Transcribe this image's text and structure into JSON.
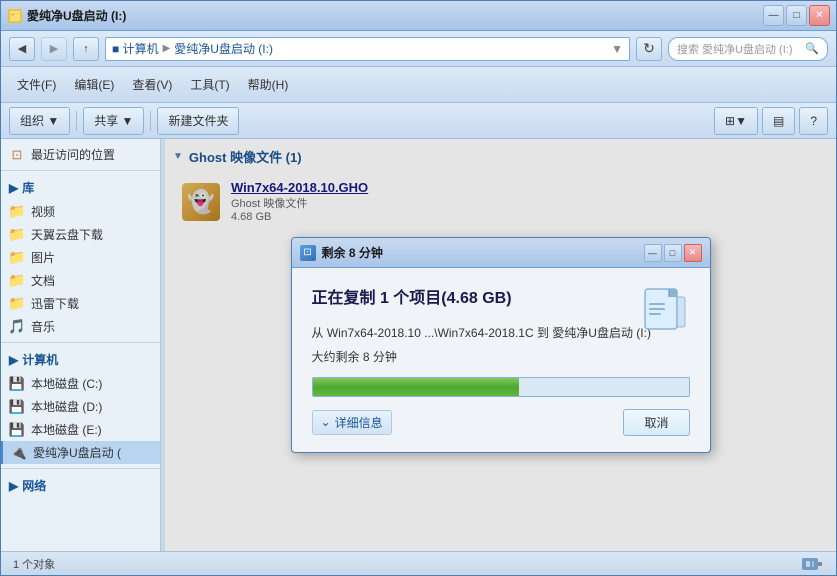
{
  "window": {
    "title": "愛纯净U盘启动 (I:)",
    "title_prefix": "计算机 ▸ 愛纯净U盘启动 (I:)"
  },
  "titlebar": {
    "minimize": "—",
    "maximize": "□",
    "close": "✕"
  },
  "address": {
    "path_parts": [
      "计算机",
      "愛纯净U盘启动 (I:)"
    ],
    "search_placeholder": "搜索 愛纯净U盘启动 (I:)"
  },
  "menus": {
    "file": "文件(F)",
    "edit": "编辑(E)",
    "view": "查看(V)",
    "tools": "工具(T)",
    "help": "帮助(H)"
  },
  "toolbar": {
    "organize": "组织 ▼",
    "share": "共享 ▼",
    "new_folder": "新建文件夹"
  },
  "sidebar": {
    "recent_label": "最近访问的位置",
    "library_label": "库",
    "items": [
      {
        "label": "视频",
        "icon": "folder"
      },
      {
        "label": "天翼云盘下载",
        "icon": "folder"
      },
      {
        "label": "图片",
        "icon": "folder"
      },
      {
        "label": "文档",
        "icon": "folder"
      },
      {
        "label": "迅雷下载",
        "icon": "folder"
      },
      {
        "label": "音乐",
        "icon": "folder"
      }
    ],
    "computer_label": "计算机",
    "drives": [
      {
        "label": "本地磁盘 (C:)",
        "icon": "drive"
      },
      {
        "label": "本地磁盘 (D:)",
        "icon": "drive"
      },
      {
        "label": "本地磁盘 (E:)",
        "icon": "drive"
      },
      {
        "label": "愛纯净U盘启动 (",
        "icon": "usb",
        "active": true
      }
    ],
    "network_label": "网络"
  },
  "content": {
    "group_name": "Ghost 映像文件 (1)",
    "file": {
      "name": "Win7x64-2018.10.GHO",
      "type": "Ghost 映像文件",
      "size": "4.68 GB"
    }
  },
  "status_bar": {
    "count": "1 个对象"
  },
  "dialog": {
    "title": "剩余 8 分钟",
    "header": "正在复制 1 个项目(4.68 GB)",
    "from_text": "从 Win7x64-2018.10 ...\\Win7x64-2018.1C 到 愛纯净U盘启动 (I:)",
    "remaining": "大约剩余 8 分钟",
    "progress_percent": 55,
    "details_label": "详细信息",
    "cancel_label": "取消",
    "controls": {
      "minimize": "—",
      "maximize": "□",
      "close": "✕"
    }
  }
}
